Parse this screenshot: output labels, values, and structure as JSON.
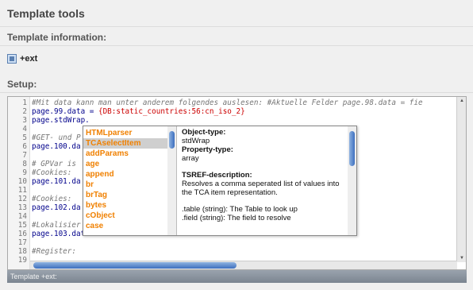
{
  "page": {
    "title": "Template tools",
    "info_heading": "Template information:",
    "ext_label": "+ext",
    "setup_heading": "Setup:",
    "status": "Template +ext:"
  },
  "editor": {
    "lines": [
      {
        "n": "1",
        "parts": [
          {
            "t": "#Mit data kann man unter anderem folgendes auslesen: #Aktuelle Felder page.98.data = fie",
            "c": "c-comment"
          }
        ]
      },
      {
        "n": "2",
        "parts": [
          {
            "t": "page.99.data = ",
            "c": "c-blue"
          },
          {
            "t": "{DB:static_countries:56:cn_iso_2}",
            "c": "c-red"
          }
        ]
      },
      {
        "n": "3",
        "parts": [
          {
            "t": "page.stdWrap.",
            "c": "c-blue"
          }
        ]
      },
      {
        "n": "4",
        "parts": []
      },
      {
        "n": "5",
        "parts": [
          {
            "t": "#GET- und P",
            "c": "c-comment"
          }
        ]
      },
      {
        "n": "6",
        "parts": [
          {
            "t": "page.100.da",
            "c": "c-blue"
          }
        ]
      },
      {
        "n": "7",
        "parts": []
      },
      {
        "n": "8",
        "parts": [
          {
            "t": "# GPVar is ",
            "c": "c-comment"
          }
        ]
      },
      {
        "n": "9",
        "parts": [
          {
            "t": "#Cookies: ",
            "c": "c-comment"
          }
        ]
      },
      {
        "n": "10",
        "parts": [
          {
            "t": "page.101.da",
            "c": "c-blue"
          }
        ]
      },
      {
        "n": "11",
        "parts": []
      },
      {
        "n": "12",
        "parts": [
          {
            "t": "#Cookies: ",
            "c": "c-comment"
          }
        ]
      },
      {
        "n": "13",
        "parts": [
          {
            "t": "page.102.da",
            "c": "c-blue"
          }
        ]
      },
      {
        "n": "14",
        "parts": []
      },
      {
        "n": "15",
        "parts": [
          {
            "t": "#Lokalisier",
            "c": "c-comment"
          }
        ]
      },
      {
        "n": "16",
        "parts": [
          {
            "t": "page.103.data",
            "c": "c-blue"
          }
        ]
      },
      {
        "n": "17",
        "parts": []
      },
      {
        "n": "18",
        "parts": [
          {
            "t": "#Register:",
            "c": "c-comment"
          }
        ]
      },
      {
        "n": "19",
        "parts": []
      }
    ]
  },
  "popup": {
    "items": [
      "HTMLparser",
      "TCAselectItem",
      "addParams",
      "age",
      "append",
      "br",
      "brTag",
      "bytes",
      "cObject",
      "case"
    ],
    "selected_index": 1,
    "desc": {
      "object_type_label": "Object-type:",
      "object_type": "stdWrap",
      "property_type_label": "Property-type:",
      "property_type": "array",
      "tsref_label": "TSREF-description:",
      "tsref_text": "Resolves a comma seperated list of values into the TCA item representation.",
      "table_line": ".table (string): The Table to look up",
      "field_line": ".field (string): The field to resolve"
    }
  }
}
